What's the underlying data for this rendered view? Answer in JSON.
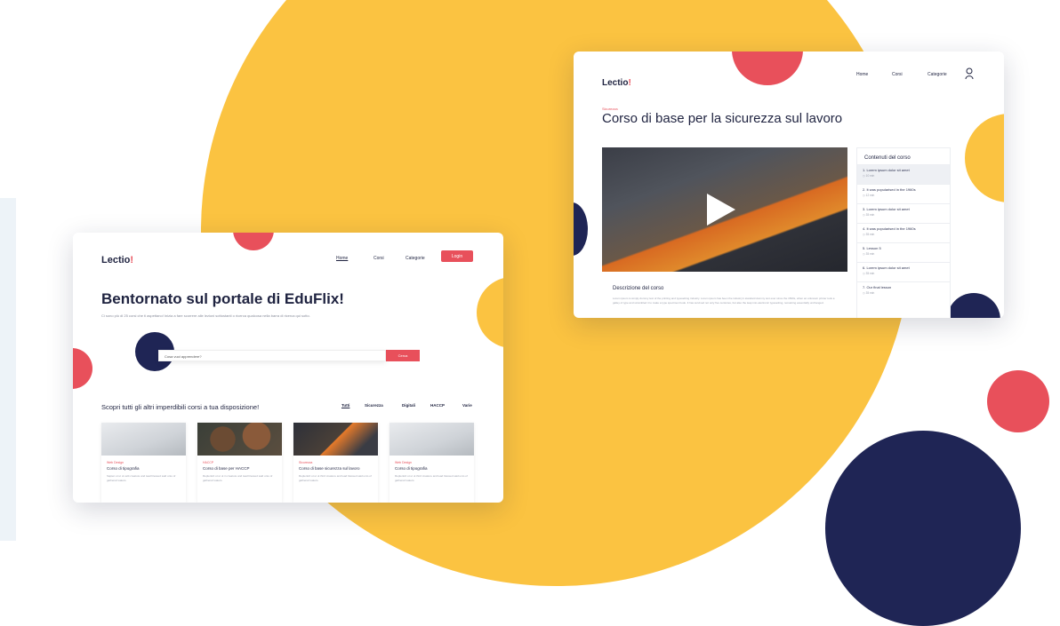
{
  "left_mockup": {
    "logo": "Lectio",
    "logo_mark": "!",
    "nav": [
      "Home",
      "Corsi",
      "Categorie"
    ],
    "login_label": "Login",
    "hero_title": "Bentornato sul portale di EduFlix!",
    "hero_subtitle": "Ci sono più di 25 corsi che ti aspettano! Inizia a fare scorrere alle lezioni sottostanti o ricerca qualcosa nella barra di ricerca qui sotto.",
    "search": {
      "placeholder": "Cosa vuoi apprendere?",
      "button": "Cerca"
    },
    "section_title": "Scopri tutti gli altri imperdibili corsi a tua disposizione!",
    "filters": [
      "Tutti",
      "Sicurezza",
      "Digitali",
      "HACCP",
      "Varie"
    ],
    "courses": [
      {
        "category": "Web Design",
        "title": "Corso di tipografia",
        "desc": "Sapien ut ut ut velit creature and lead blessed said unto of gathered waters.",
        "thumb": "laptop"
      },
      {
        "category": "HACCP",
        "title": "Corso di base per HACCP",
        "desc": "Replenish ut ut ut in creature and lead blessed said unto of gathered waters.",
        "thumb": "food"
      },
      {
        "category": "Sicurezza",
        "title": "Corso di base sicurezza sul lavoro",
        "desc": "Replenish ut ut ut third creature and lead blessed said unto of gathered waters.",
        "thumb": "worker"
      },
      {
        "category": "Web Design",
        "title": "Corso di tipografia",
        "desc": "Replenish ut ut ut third creature and lead blessed said unto of gathered waters.",
        "thumb": "laptop"
      }
    ]
  },
  "right_mockup": {
    "logo": "Lectio",
    "logo_mark": "!",
    "nav": [
      "Home",
      "Corsi",
      "Categorie"
    ],
    "category": "Sicurezza",
    "title": "Corso di base per la sicurezza sul lavoro",
    "description_title": "Descrizione del corso",
    "description_text": "Lorem ipsum is simply dummy text of the printing and typesetting industry. Lorem ipsum has been the industry's standard dummy text ever since the 1500s, when an unknown printer took a galley of type and scrambled it to make a type specimen book. It has survived not only five centuries, but also the leap into electronic typesetting, remaining essentially unchanged.",
    "toc_title": "Contenuti del corso",
    "lessons": [
      {
        "label": "1. Lorem ipsum dolor sit amet",
        "duration": "10 min"
      },
      {
        "label": "2. It was popularised in the 1960s",
        "duration": "12 min"
      },
      {
        "label": "3. Lorem ipsum dolor sit amet",
        "duration": "35 min"
      },
      {
        "label": "4. It was popularised in the 1960s",
        "duration": "35 min"
      },
      {
        "label": "5. Lesson 5",
        "duration": "35 min"
      },
      {
        "label": "6. Lorem ipsum dolor sit amet",
        "duration": "35 min"
      },
      {
        "label": "7. Our final lesson",
        "duration": "35 min"
      }
    ]
  },
  "colors": {
    "yellow": "#fbc341",
    "red": "#e8505b",
    "navy": "#1f2555",
    "white": "#ffffff"
  },
  "icons": [
    "play-icon",
    "user-icon",
    "clock-icon"
  ]
}
